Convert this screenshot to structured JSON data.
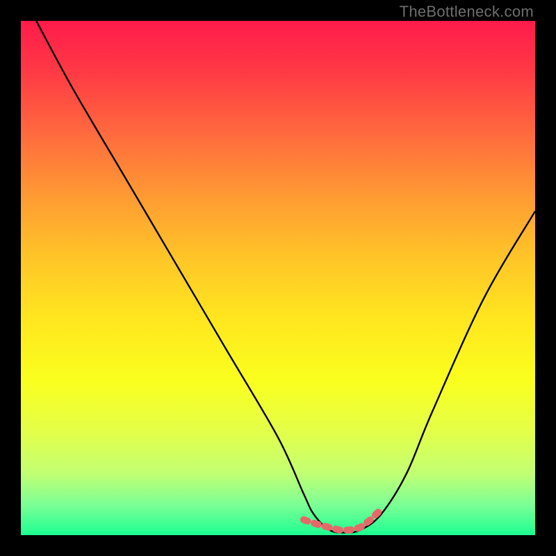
{
  "watermark": {
    "text": "TheBottleneck.com"
  },
  "colors": {
    "frame_bg": "#000000",
    "curve": "#000000",
    "marker": "#e46a6a",
    "gradient_top": "#ff1b4b",
    "gradient_bottom": "#1cff92"
  },
  "chart_data": {
    "type": "line",
    "title": "",
    "xlabel": "",
    "ylabel": "",
    "xlim": [
      0,
      100
    ],
    "ylim": [
      0,
      100
    ],
    "grid": false,
    "legend": false,
    "series": [
      {
        "name": "black-curve",
        "x": [
          3,
          10,
          20,
          30,
          40,
          50,
          55,
          57,
          60,
          63,
          66,
          70,
          75,
          80,
          90,
          100
        ],
        "y": [
          100,
          87,
          70,
          53,
          36,
          19,
          8,
          4,
          1,
          0.5,
          1,
          4,
          12,
          24,
          46,
          63
        ]
      },
      {
        "name": "pink-flat-segment",
        "x": [
          55,
          58,
          60,
          62,
          64,
          66,
          68,
          70
        ],
        "y": [
          3,
          2,
          1.5,
          1,
          1,
          1.5,
          3,
          5
        ]
      }
    ],
    "annotations": [
      {
        "text": "TheBottleneck.com",
        "position": "top-right"
      }
    ]
  }
}
